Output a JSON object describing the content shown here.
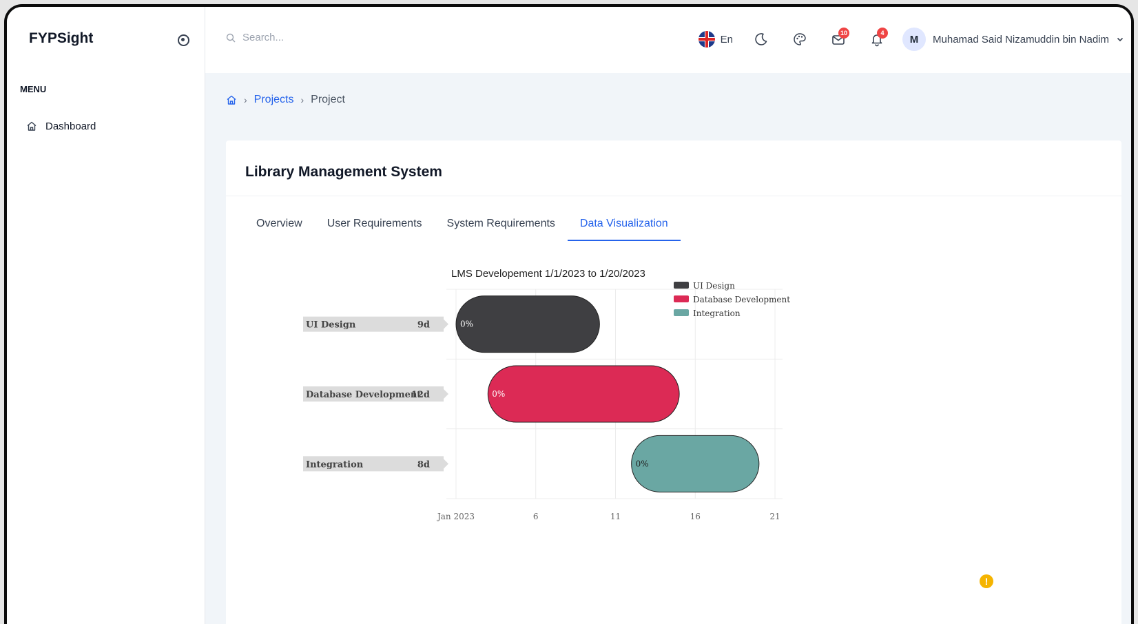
{
  "app": {
    "name": "FYPSight"
  },
  "sidebar": {
    "menu_title": "MENU",
    "items": [
      {
        "label": "Dashboard",
        "icon": "home-icon"
      }
    ]
  },
  "topbar": {
    "search_placeholder": "Search...",
    "language": "En",
    "mail_count": "10",
    "notification_count": "4",
    "user_initial": "M",
    "user_name": "Muhamad Said Nizamuddin bin Nadim"
  },
  "breadcrumb": {
    "home_icon": "home-icon",
    "items": [
      "Projects",
      "Project"
    ]
  },
  "project": {
    "title": "Library Management System"
  },
  "tabs": [
    {
      "label": "Overview"
    },
    {
      "label": "User Requirements"
    },
    {
      "label": "System Requirements"
    },
    {
      "label": "Data Visualization",
      "active": true
    }
  ],
  "chart_data": {
    "type": "gantt",
    "title": "LMS Developement 1/1/2023 to 1/20/2023",
    "x_ticks": [
      "Jan 2023",
      "6",
      "11",
      "16",
      "21"
    ],
    "xlim": [
      "2023-01-01",
      "2023-01-21"
    ],
    "grid": true,
    "legend_position": "top-right",
    "tasks": [
      {
        "name": "UI Design",
        "duration_label": "9d",
        "start": "2023-01-01",
        "end": "2023-01-10",
        "progress_label": "0%",
        "color": "#3f3f42"
      },
      {
        "name": "Database Development",
        "duration_label": "12d",
        "start": "2023-01-03",
        "end": "2023-01-15",
        "progress_label": "0%",
        "color": "#dc2a55"
      },
      {
        "name": "Integration",
        "duration_label": "8d",
        "start": "2023-01-12",
        "end": "2023-01-20",
        "progress_label": "0%",
        "color": "#6aa7a3"
      }
    ],
    "legend": [
      "UI Design",
      "Database Development",
      "Integration"
    ]
  },
  "colors": {
    "accent": "#2563eb",
    "badge": "#ef4444",
    "warning": "#f5b400"
  }
}
